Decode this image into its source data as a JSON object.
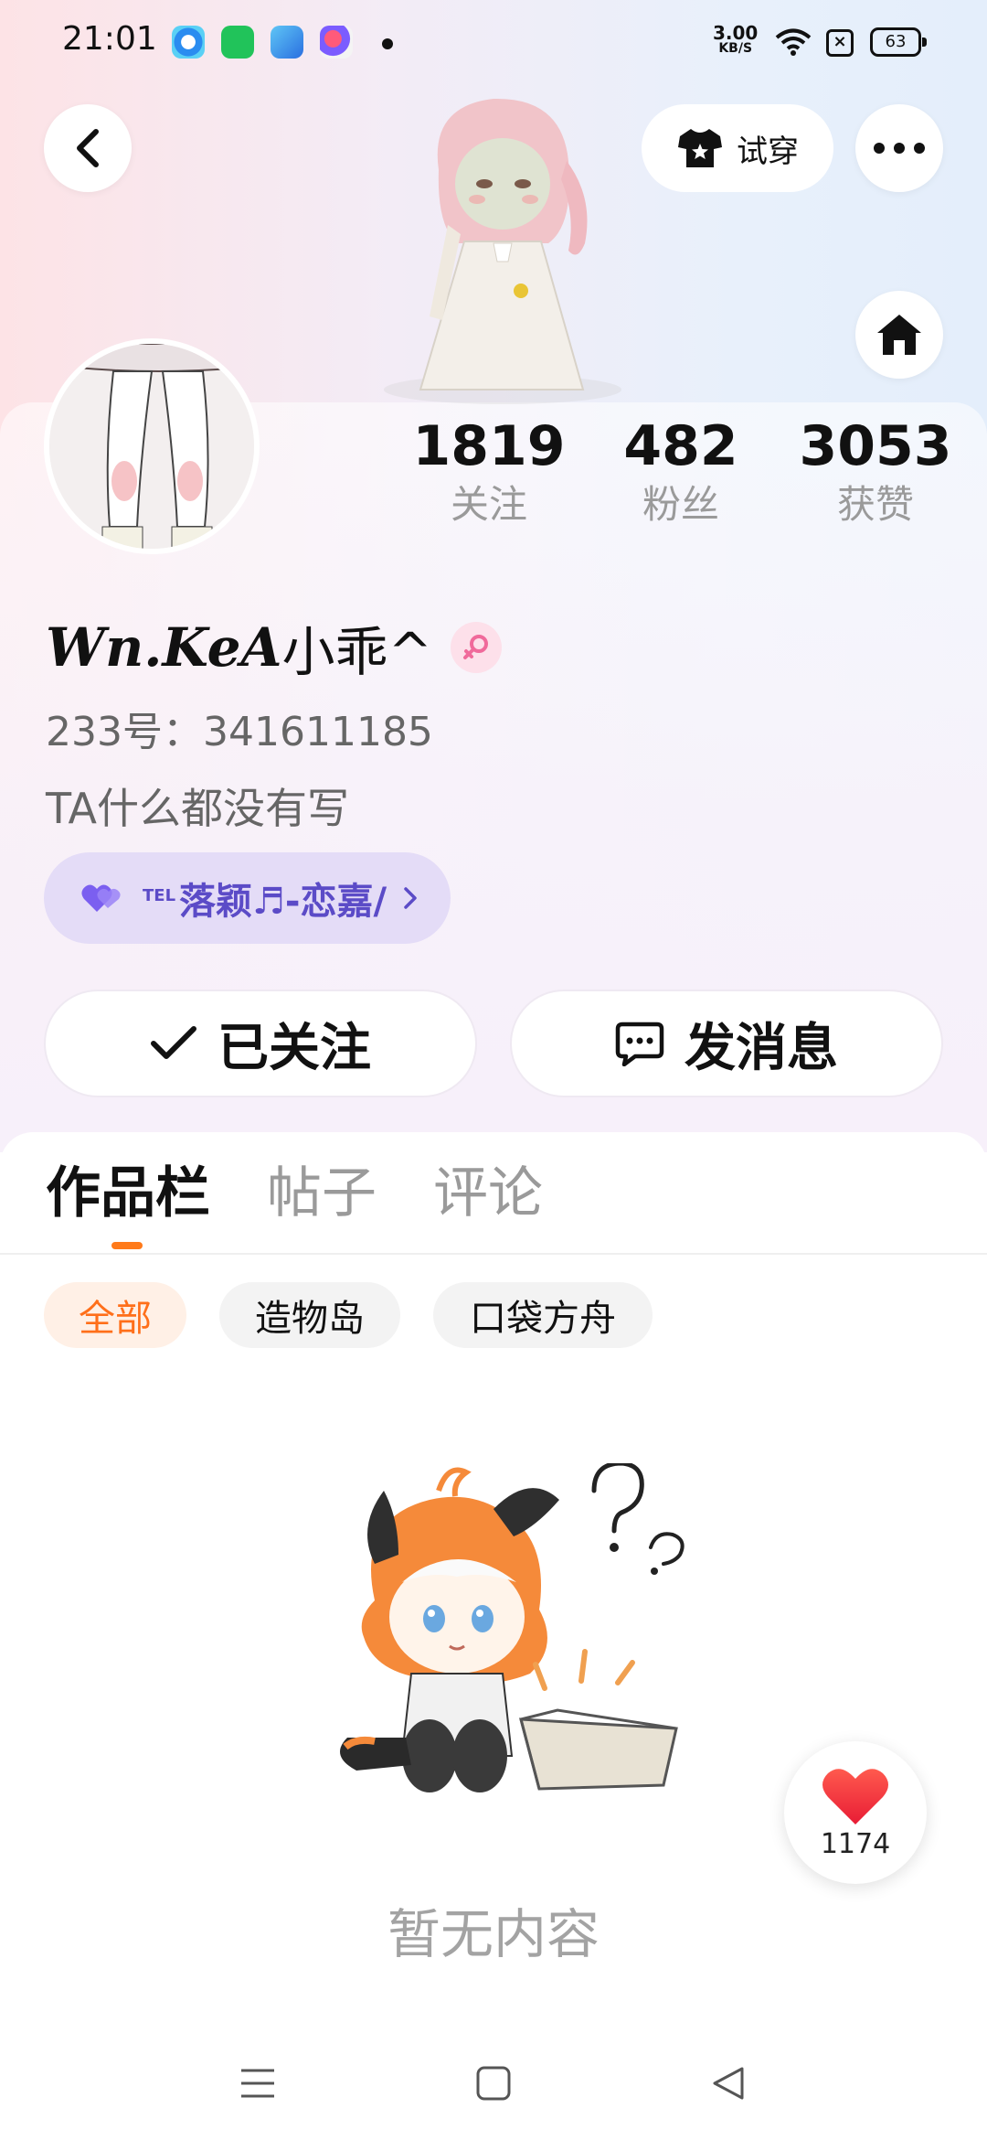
{
  "status_bar": {
    "time": "21:01",
    "net_speed_value": "3.00",
    "net_speed_unit": "KB/S",
    "battery": "63"
  },
  "header": {
    "tryon_label": "试穿"
  },
  "profile": {
    "name_fancy": "Wn.KeA",
    "name_cn": "小乖^",
    "uid": "233号：341611185",
    "bio": "TA什么都没有写",
    "fan_club_prefix": "TEL",
    "fan_club": "落颖♬-恋嘉/"
  },
  "stats": [
    {
      "value": "1819",
      "label": "关注"
    },
    {
      "value": "482",
      "label": "粉丝"
    },
    {
      "value": "3053",
      "label": "获赞"
    }
  ],
  "actions": {
    "follow_label": "已关注",
    "message_label": "发消息"
  },
  "tabs": [
    {
      "label": "作品栏",
      "active": true
    },
    {
      "label": "帖子",
      "active": false
    },
    {
      "label": "评论",
      "active": false
    }
  ],
  "filters": [
    {
      "label": "全部",
      "active": true
    },
    {
      "label": "造物岛",
      "active": false
    },
    {
      "label": "口袋方舟",
      "active": false
    }
  ],
  "empty_state": {
    "text": "暂无内容"
  },
  "like_fab": {
    "count": "1174"
  },
  "colors": {
    "accent": "#ff7a1a",
    "fan_club_text": "#5b4bc7",
    "fan_club_bg": "#e4dcf7",
    "gender_female": "#f06a9b"
  }
}
